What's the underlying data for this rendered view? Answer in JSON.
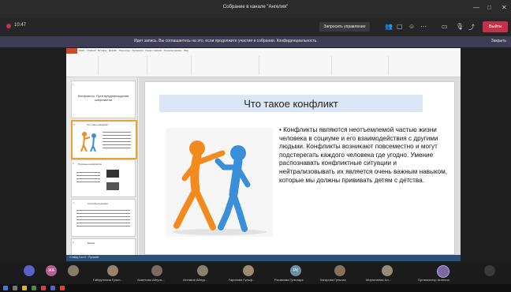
{
  "window": {
    "title": "Собрание в канале \"Ангелия\"",
    "controls": [
      "—",
      "□",
      "✕"
    ]
  },
  "toolbar": {
    "timer": "10:47",
    "share_label": "Запросить управление",
    "icons": [
      "participants-icon",
      "chat-icon",
      "reactions-icon",
      "hand-icon",
      "more-icon",
      "camera-icon",
      "mic-icon",
      "share-icon"
    ],
    "leave_label": "Выйти"
  },
  "banner": {
    "text": "Идет запись. Вы соглашаетесь на это, если продолжите участие в собрании. Конфиденциальность.",
    "dismiss": "Закрыть"
  },
  "ppt": {
    "status": "Слайд 2 из 5 · Русский",
    "ribbon_tabs": [
      "Файл",
      "Главная",
      "Вставка",
      "Дизайн",
      "Переходы",
      "Анимация",
      "Показ слайдов",
      "Рецензирование",
      "Вид"
    ],
    "thumbnails": [
      {
        "num": "1",
        "title": "Конфликты. Пути предупреждения конфликтов"
      },
      {
        "num": "2",
        "title": "Что такое конфликт"
      },
      {
        "num": "3",
        "title": "Причины конфликтов"
      },
      {
        "num": "4",
        "title": "Способы решения"
      },
      {
        "num": "5",
        "title": "Вывод"
      }
    ],
    "slide": {
      "title": "Что такое конфликт",
      "body": "Конфликты являются неотъемлемой частью жизни человека в социуме и его взаимодействия с другими людьми. Конфликты возникают повсеместно и могут подстерегать каждого человека где угодно. Умение распознавать конфликтные ситуации и нейтрализовывать их является очень важным навыком, которые мы должны прививать детям с детства."
    }
  },
  "participants": [
    {
      "initials": "",
      "name": ""
    },
    {
      "initials": "ЖА",
      "name": ""
    },
    {
      "initials": "",
      "name": ""
    },
    {
      "initials": "",
      "name": "Гайфуллина Гульн..."
    },
    {
      "initials": "",
      "name": "Ахметова Айгуль..."
    },
    {
      "initials": "",
      "name": "Ахтямов Айнур..."
    },
    {
      "initials": "",
      "name": "Гарипова Гульф..."
    },
    {
      "initials": "РК",
      "name": "Рахимова Гульнара"
    },
    {
      "initials": "",
      "name": "Кагирова Гульназ"
    },
    {
      "initials": "",
      "name": "Миргалиева Ал..."
    },
    {
      "initials": "",
      "name": "Организатор Ангелия"
    },
    {
      "initials": "",
      "name": ""
    }
  ],
  "colors": {
    "leave": "#c4314b",
    "banner": "#3d3d56",
    "ppt_accent": "#d24726"
  }
}
